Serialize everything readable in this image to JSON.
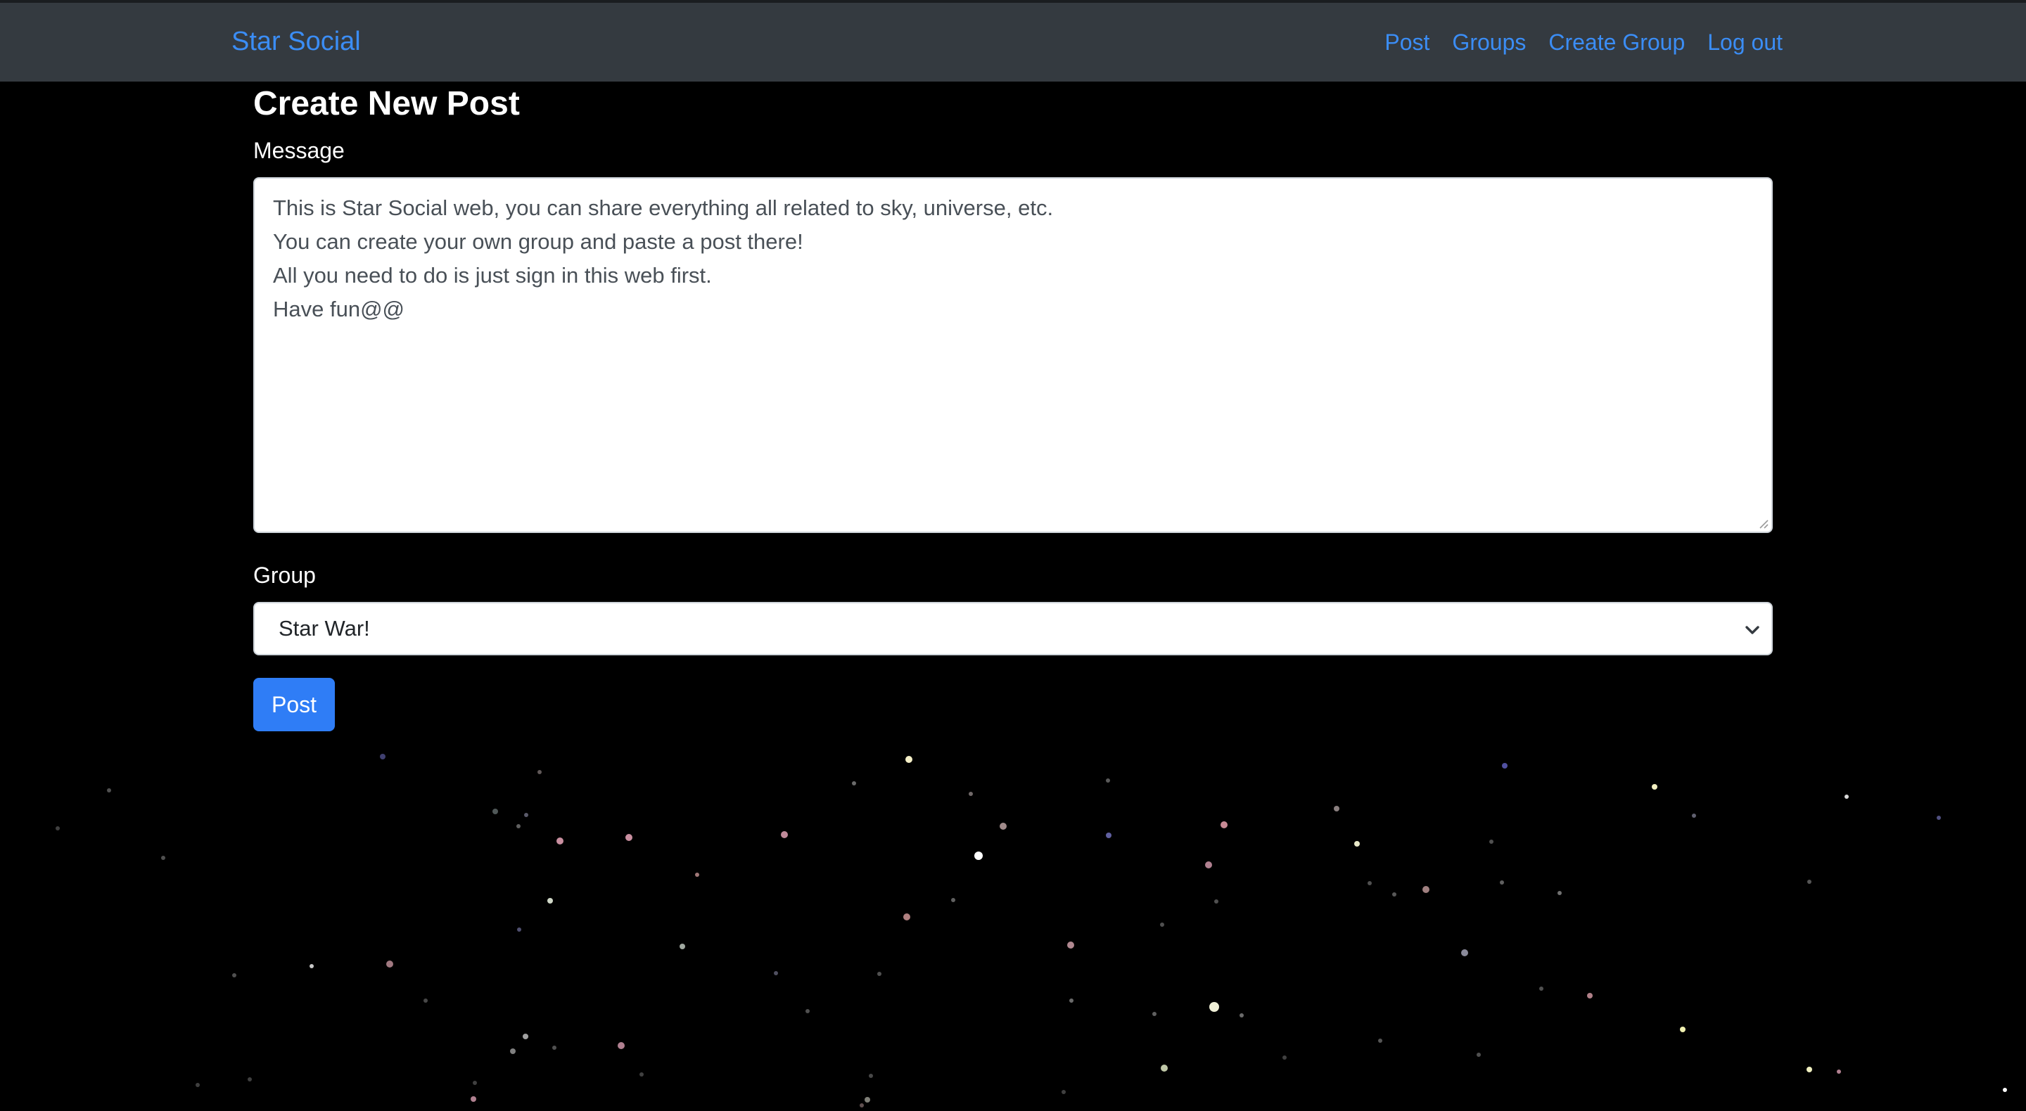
{
  "navbar": {
    "brand": "Star Social",
    "links": [
      {
        "label": "Post"
      },
      {
        "label": "Groups"
      },
      {
        "label": "Create Group"
      },
      {
        "label": "Log out"
      }
    ]
  },
  "form": {
    "title": "Create New Post",
    "message_label": "Message",
    "message_value": "This is Star Social web, you can share everything all related to sky, universe, etc.\nYou can create your own group and paste a post there!\nAll you need to do is just sign in this web first.\nHave fun@@",
    "group_label": "Group",
    "group_selected": "Star War!",
    "submit_label": "Post"
  },
  "icons": {
    "select_chevron": "chevron-down-icon",
    "textarea_resize": "resize-grip-icon"
  },
  "colors": {
    "navbar_bg": "#343a40",
    "link": "#3b8df5",
    "primary_button": "#2f7df6",
    "page_bg": "#000000"
  }
}
